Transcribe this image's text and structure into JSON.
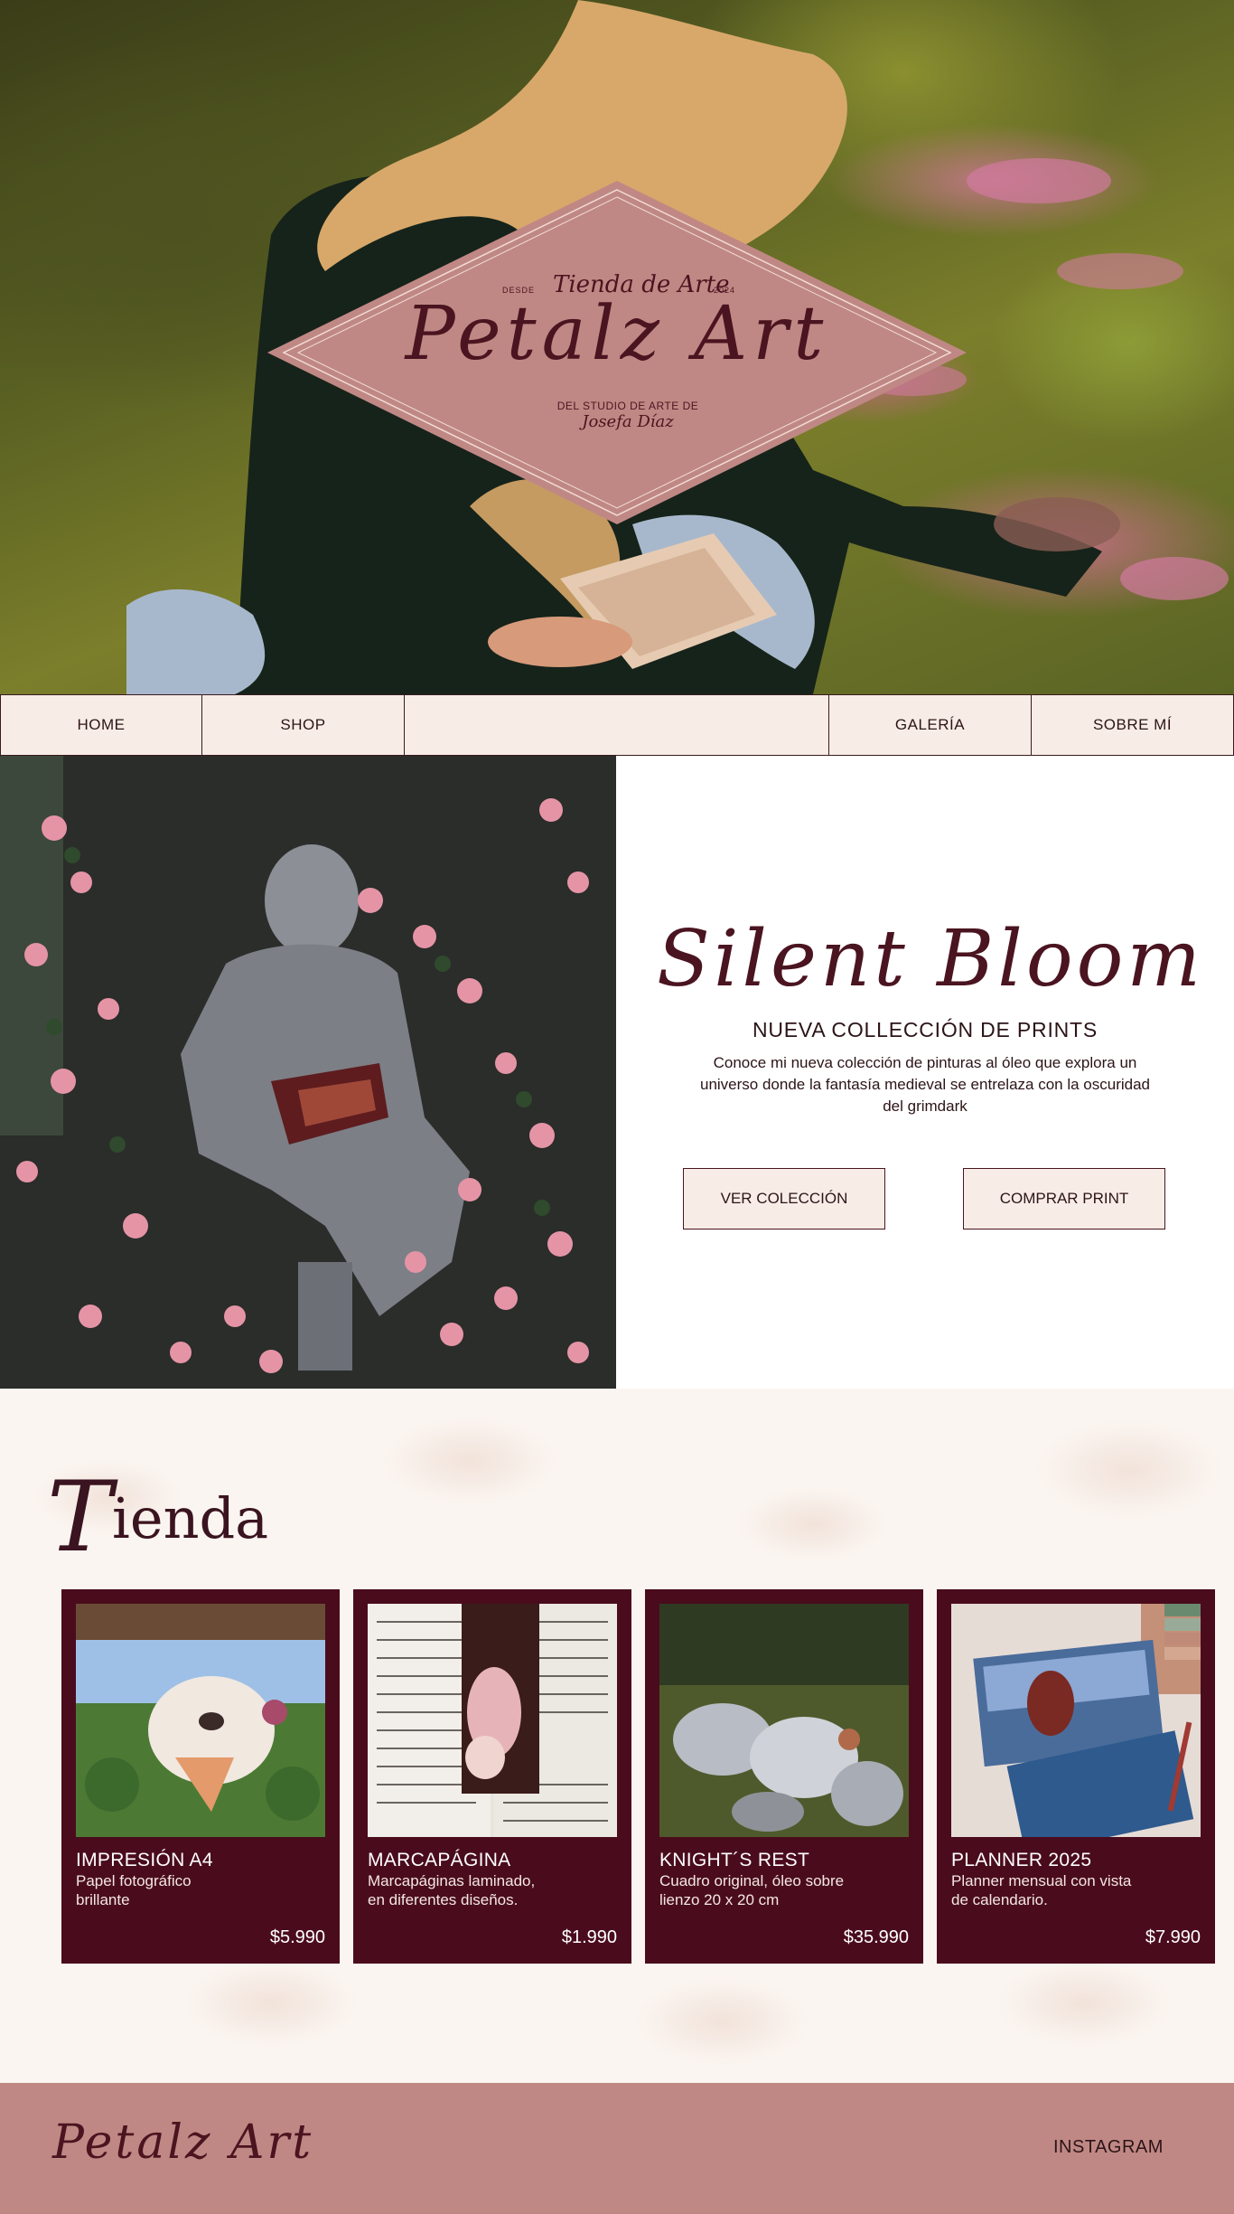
{
  "hero": {
    "logo_small_left": "DESDE",
    "logo_script_top": "Tienda de Arte",
    "logo_small_right": "2024",
    "logo_title": "Petalz Art",
    "logo_studio_line": "DEL STUDIO DE ARTE DE",
    "logo_artist": "Josefa Díaz"
  },
  "nav": {
    "home": "HOME",
    "shop": "SHOP",
    "galeria": "GALERÍA",
    "sobre": "SOBRE MÍ"
  },
  "feature": {
    "title": "Silent Bloom",
    "subtitle": "NUEVA COLLECCIÓN DE PRINTS",
    "description": "Conoce mi nueva colección de pinturas al óleo que explora un universo donde la fantasía medieval se entrelaza con la oscuridad del grimdark",
    "btn_ver": "VER COLECCIÓN",
    "btn_comprar": "COMPRAR PRINT"
  },
  "shop": {
    "title_cap": "T",
    "title_rest": "ienda",
    "products": [
      {
        "name": "IMPRESIÓN A4",
        "desc_line1": "Papel fotográfico",
        "desc_line2": "brillante",
        "price": "$5.990"
      },
      {
        "name": "MARCAPÁGINA",
        "desc_line1": "Marcapáginas laminado,",
        "desc_line2": "en diferentes diseños.",
        "price": "$1.990"
      },
      {
        "name": "KNIGHT´S REST",
        "desc_line1": "Cuadro original, óleo sobre",
        "desc_line2": "lienzo 20 x 20 cm",
        "price": "$35.990"
      },
      {
        "name": "PLANNER 2025",
        "desc_line1": "Planner mensual con vista",
        "desc_line2": "de calendario.",
        "price": "$7.990"
      }
    ]
  },
  "footer": {
    "logo": "Petalz Art",
    "instagram": "INSTAGRAM"
  },
  "colors": {
    "burgundy": "#4a0c1c",
    "dusty_rose": "#c08884",
    "cream": "#f7ede6"
  }
}
